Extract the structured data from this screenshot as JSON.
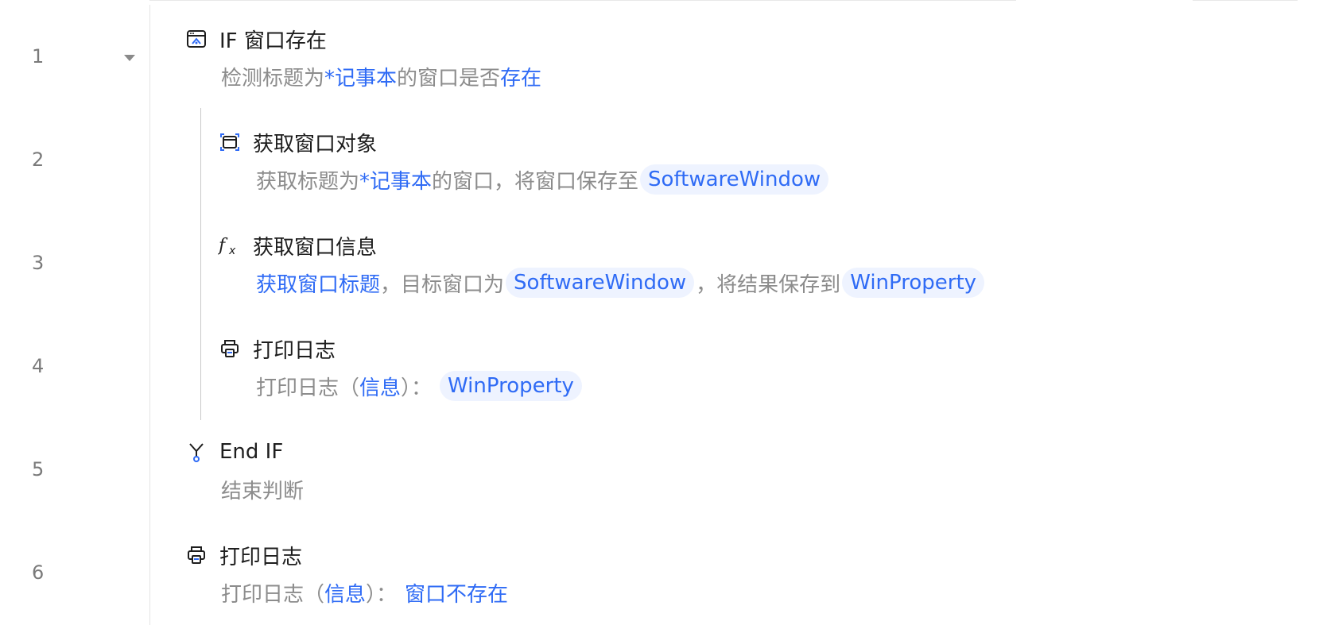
{
  "colors": {
    "accent": "#2f6bf5",
    "pill_bg": "#eef3ff",
    "title_text": "#1e1e1e",
    "desc_text": "#8c8c8c",
    "line_number": "#7a7a7a"
  },
  "steps": [
    {
      "number": "1",
      "icon": "window-exists-icon",
      "title": "IF 窗口存在",
      "desc": {
        "t1": "检测标题为",
        "h1": "*记事本",
        "t2": "的窗口是否",
        "h2": "存在"
      }
    },
    {
      "number": "2",
      "icon": "window-capture-icon",
      "title": "获取窗口对象",
      "desc": {
        "t1": "获取标题为",
        "h1": "*记事本",
        "t2": "的窗口，将窗口保存至",
        "var1": "SoftwareWindow"
      }
    },
    {
      "number": "3",
      "icon": "function-fx-icon",
      "title": "获取窗口信息",
      "desc": {
        "h1": "获取窗口标题",
        "t1": "，目标窗口为",
        "var1": "SoftwareWindow",
        "t2": "，将结果保存到",
        "var2": "WinProperty"
      }
    },
    {
      "number": "4",
      "icon": "printer-icon",
      "title": "打印日志",
      "desc": {
        "t1": "打印日志（",
        "h1": "信息",
        "t2": "）：",
        "var1": "WinProperty"
      }
    },
    {
      "number": "5",
      "icon": "branch-end-icon",
      "title": "End IF",
      "desc": {
        "t1": "结束判断"
      }
    },
    {
      "number": "6",
      "icon": "printer-icon",
      "title": "打印日志",
      "desc": {
        "t1": "打印日志（",
        "h1": "信息",
        "t2": "）：",
        "h2": "窗口不存在"
      }
    }
  ]
}
